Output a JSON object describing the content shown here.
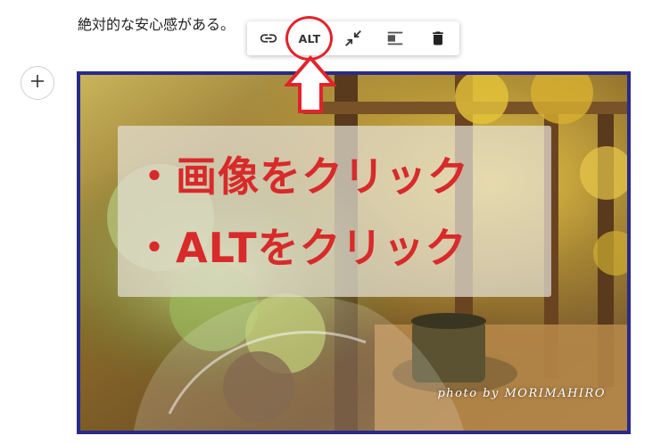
{
  "body_text": "絶対的な安心感がある。",
  "toolbar": {
    "link_icon": "link-icon",
    "alt_label": "ALT",
    "resize_icon": "collapse-arrows-icon",
    "align_icon": "align-left-icon",
    "delete_icon": "trash-icon"
  },
  "add_block_icon": "plus-icon",
  "image": {
    "overlay_line_1": "・画像をクリック",
    "overlay_line_2": "・ALTをクリック",
    "credit": "photo by MORIMAHIRO",
    "frame_color": "#2a2a88",
    "overlay_text_color": "#d82a2a"
  },
  "annotation": {
    "ring_color": "#e2232b",
    "arrow_color": "#e2232b"
  }
}
